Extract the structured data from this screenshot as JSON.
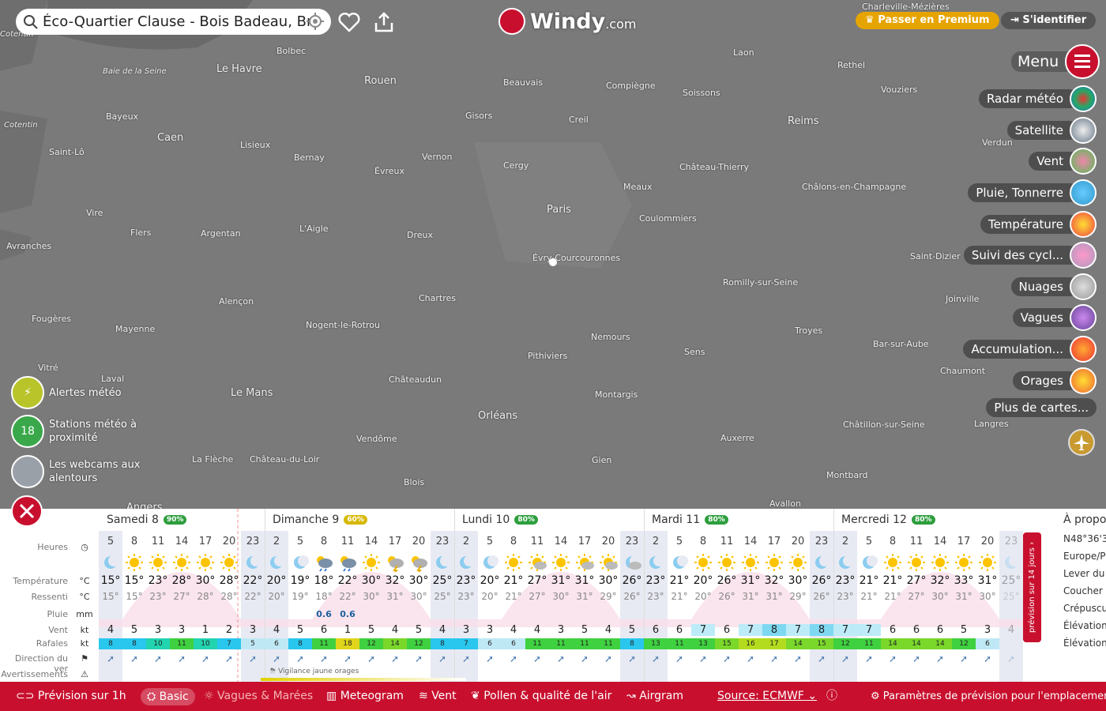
{
  "search": {
    "value": "Éco-Quartier Clause - Bois Badeau, Br"
  },
  "brand": {
    "name": "Windy",
    "suffix": ".com"
  },
  "header": {
    "premium": "Passer en Premium",
    "login": "S'identifier"
  },
  "menu": {
    "label": "Menu"
  },
  "layers": [
    "Radar météo",
    "Satellite",
    "Vent",
    "Pluie, Tonnerre",
    "Température",
    "Suivi des cycl...",
    "Nuages",
    "Vagues",
    "Accumulation...",
    "Orages",
    "Plus de cartes..."
  ],
  "left_buttons": {
    "alerts": "Alertes météo",
    "stations": "Stations météo à proximité",
    "stations_count": "18",
    "webcams": "Les webcams aux alentours"
  },
  "map_labels": [
    {
      "name": "Cotentin",
      "cls": "sc"
    },
    {
      "name": "Baie de la Seine",
      "cls": "sc"
    },
    {
      "name": "Le Havre",
      "cls": "big"
    },
    {
      "name": "Bolbec",
      "cls": ""
    },
    {
      "name": "Rouen",
      "cls": "big"
    },
    {
      "name": "Beauvais",
      "cls": ""
    },
    {
      "name": "Compiègne",
      "cls": ""
    },
    {
      "name": "Laon",
      "cls": ""
    },
    {
      "name": "Rethel",
      "cls": ""
    },
    {
      "name": "Charleville-Mézières",
      "cls": ""
    },
    {
      "name": "Vouziers",
      "cls": ""
    },
    {
      "name": "Soissons",
      "cls": ""
    },
    {
      "name": "Bayeux",
      "cls": ""
    },
    {
      "name": "Cotentin",
      "cls": "sc"
    },
    {
      "name": "Caen",
      "cls": "big"
    },
    {
      "name": "Gisors",
      "cls": ""
    },
    {
      "name": "Creil",
      "cls": ""
    },
    {
      "name": "Reims",
      "cls": "big"
    },
    {
      "name": "Saint-Lô",
      "cls": ""
    },
    {
      "name": "Lisieux",
      "cls": ""
    },
    {
      "name": "Bernay",
      "cls": ""
    },
    {
      "name": "Évreux",
      "cls": ""
    },
    {
      "name": "Vernon",
      "cls": ""
    },
    {
      "name": "Cergy",
      "cls": ""
    },
    {
      "name": "Château-Thierry",
      "cls": ""
    },
    {
      "name": "Verdun",
      "cls": ""
    },
    {
      "name": "Meaux",
      "cls": ""
    },
    {
      "name": "Châlons-en-Champagne",
      "cls": ""
    },
    {
      "name": "Paris",
      "cls": "big"
    },
    {
      "name": "Vire",
      "cls": ""
    },
    {
      "name": "Coulommiers",
      "cls": ""
    },
    {
      "name": "Flers",
      "cls": ""
    },
    {
      "name": "Argentan",
      "cls": ""
    },
    {
      "name": "L'Aigle",
      "cls": ""
    },
    {
      "name": "Dreux",
      "cls": ""
    },
    {
      "name": "Avranches",
      "cls": ""
    },
    {
      "name": "Évry-Courcouronnes",
      "cls": ""
    },
    {
      "name": "Saint-Dizier",
      "cls": ""
    },
    {
      "name": "Romilly-sur-Seine",
      "cls": ""
    },
    {
      "name": "Chartres",
      "cls": ""
    },
    {
      "name": "Alençon",
      "cls": ""
    },
    {
      "name": "Joinville",
      "cls": ""
    },
    {
      "name": "Fougères",
      "cls": ""
    },
    {
      "name": "Nogent-le-Rotrou",
      "cls": ""
    },
    {
      "name": "Mayenne",
      "cls": ""
    },
    {
      "name": "Troyes",
      "cls": ""
    },
    {
      "name": "Nemours",
      "cls": ""
    },
    {
      "name": "Bar-sur-Aube",
      "cls": ""
    },
    {
      "name": "Sens",
      "cls": ""
    },
    {
      "name": "Pithiviers",
      "cls": ""
    },
    {
      "name": "Vitré",
      "cls": ""
    },
    {
      "name": "Chaumont",
      "cls": ""
    },
    {
      "name": "Laval",
      "cls": ""
    },
    {
      "name": "Châteaudun",
      "cls": ""
    },
    {
      "name": "Le Mans",
      "cls": "big"
    },
    {
      "name": "Montargis",
      "cls": ""
    },
    {
      "name": "Orléans",
      "cls": "big"
    },
    {
      "name": "Châtillon-sur-Seine",
      "cls": ""
    },
    {
      "name": "Langres",
      "cls": ""
    },
    {
      "name": "Vendôme",
      "cls": ""
    },
    {
      "name": "Auxerre",
      "cls": ""
    },
    {
      "name": "La Flèche",
      "cls": ""
    },
    {
      "name": "Château-du-Loir",
      "cls": ""
    },
    {
      "name": "Gien",
      "cls": ""
    },
    {
      "name": "Blois",
      "cls": ""
    },
    {
      "name": "Montbard",
      "cls": ""
    },
    {
      "name": "Angers",
      "cls": "big"
    },
    {
      "name": "Avallon",
      "cls": ""
    }
  ],
  "forecast": {
    "row_labels": {
      "hours": "Heures",
      "temp": "Température",
      "feels": "Ressenti",
      "rain": "Pluie",
      "wind": "Vent",
      "gusts": "Rafales",
      "direction": "Direction du ver",
      "warnings": "Avertissements"
    },
    "units": {
      "temp": "°C",
      "feels": "°C",
      "rain": "mm",
      "wind": "kt",
      "gusts": "kt"
    },
    "days": [
      {
        "name": "Samedi 8",
        "pct": "90%",
        "color": "#2e9e3e"
      },
      {
        "name": "Dimanche 9",
        "pct": "60%",
        "color": "#d6b800"
      },
      {
        "name": "Lundi 10",
        "pct": "80%",
        "color": "#2e9e3e"
      },
      {
        "name": "Mardi 11",
        "pct": "80%",
        "color": "#2e9e3e"
      },
      {
        "name": "Mercredi 12",
        "pct": "80%",
        "color": "#2e9e3e"
      }
    ],
    "hours": [
      "5",
      "8",
      "11",
      "14",
      "17",
      "20",
      "23",
      "2",
      "5",
      "8",
      "11",
      "14",
      "17",
      "20",
      "23",
      "2",
      "5",
      "8",
      "11",
      "14",
      "17",
      "20",
      "23",
      "2",
      "5",
      "8",
      "11",
      "14",
      "17",
      "20",
      "23",
      "2",
      "5",
      "8",
      "11",
      "14",
      "17",
      "20",
      "23"
    ],
    "temps": [
      "15°",
      "15°",
      "23°",
      "28°",
      "30°",
      "28°",
      "22°",
      "20°",
      "19°",
      "18°",
      "22°",
      "30°",
      "32°",
      "30°",
      "25°",
      "23°",
      "20°",
      "21°",
      "27°",
      "31°",
      "31°",
      "30°",
      "26°",
      "23°",
      "21°",
      "20°",
      "26°",
      "31°",
      "32°",
      "30°",
      "26°",
      "23°",
      "21°",
      "21°",
      "27°",
      "32°",
      "33°",
      "31°",
      "25°"
    ],
    "feels": [
      "15°",
      "15°",
      "23°",
      "27°",
      "28°",
      "28°",
      "22°",
      "20°",
      "19°",
      "18°",
      "22°",
      "30°",
      "31°",
      "30°",
      "25°",
      "23°",
      "20°",
      "21°",
      "27°",
      "30°",
      "31°",
      "29°",
      "26°",
      "23°",
      "21°",
      "20°",
      "26°",
      "31°",
      "31°",
      "29°",
      "26°",
      "23°",
      "21°",
      "21°",
      "27°",
      "30°",
      "31°",
      "30°",
      "25°"
    ],
    "rain": [
      "",
      "",
      "",
      "",
      "",
      "",
      "",
      "",
      "",
      "0.6",
      "0.6",
      "",
      "",
      "",
      "",
      "",
      "",
      "",
      "",
      "",
      "",
      "",
      "",
      "",
      "",
      "",
      "",
      "",
      "",
      "",
      "",
      "",
      "",
      "",
      "",
      "",
      "",
      "",
      ""
    ],
    "wind": [
      "4",
      "5",
      "3",
      "3",
      "1",
      "2",
      "3",
      "4",
      "5",
      "6",
      "1",
      "5",
      "4",
      "5",
      "4",
      "3",
      "3",
      "4",
      "4",
      "3",
      "5",
      "4",
      "5",
      "6",
      "6",
      "7",
      "6",
      "7",
      "8",
      "7",
      "8",
      "7",
      "7",
      "6",
      "6",
      "6",
      "5",
      "3",
      "4"
    ],
    "gusts": [
      "8",
      "8",
      "10",
      "11",
      "10",
      "7",
      "5",
      "6",
      "8",
      "11",
      "18",
      "12",
      "14",
      "12",
      "8",
      "7",
      "6",
      "6",
      "11",
      "11",
      "11",
      "11",
      "8",
      "13",
      "11",
      "13",
      "15",
      "16",
      "17",
      "14",
      "15",
      "12",
      "11",
      "14",
      "14",
      "14",
      "12",
      "6",
      ""
    ],
    "icons": [
      "moon",
      "sun",
      "sun",
      "sun",
      "sun",
      "sun",
      "moon",
      "moon",
      "moon",
      "rain",
      "rain",
      "sun",
      "storm",
      "storm",
      "moon",
      "moon",
      "moon",
      "sun",
      "sunc",
      "sun",
      "sunc",
      "sunc",
      "moonc",
      "moon",
      "moon",
      "sun",
      "sun",
      "sun",
      "sun",
      "sun",
      "moon",
      "moon",
      "moon",
      "sun",
      "sun",
      "sun",
      "sun",
      "sun",
      "moon"
    ],
    "warning_text": "Vigilance jaune orages",
    "side_tab": "prévision sur 14 jours",
    "info": [
      "À propo",
      "N48°36'3",
      "Europe/P",
      "Lever du",
      "Coucher",
      "Crépuscu",
      "Élévation",
      "Élévation"
    ]
  },
  "bottombar": {
    "forecast1h": "Prévision sur 1h",
    "basic": "Basic",
    "waves": "Vagues & Marées",
    "meteogram": "Meteogram",
    "wind": "Vent",
    "pollen": "Pollen & qualité de l'air",
    "airgram": "Airgram",
    "source": "Source: ECMWF",
    "settings": "Paramètres de prévision pour l'emplacement"
  }
}
